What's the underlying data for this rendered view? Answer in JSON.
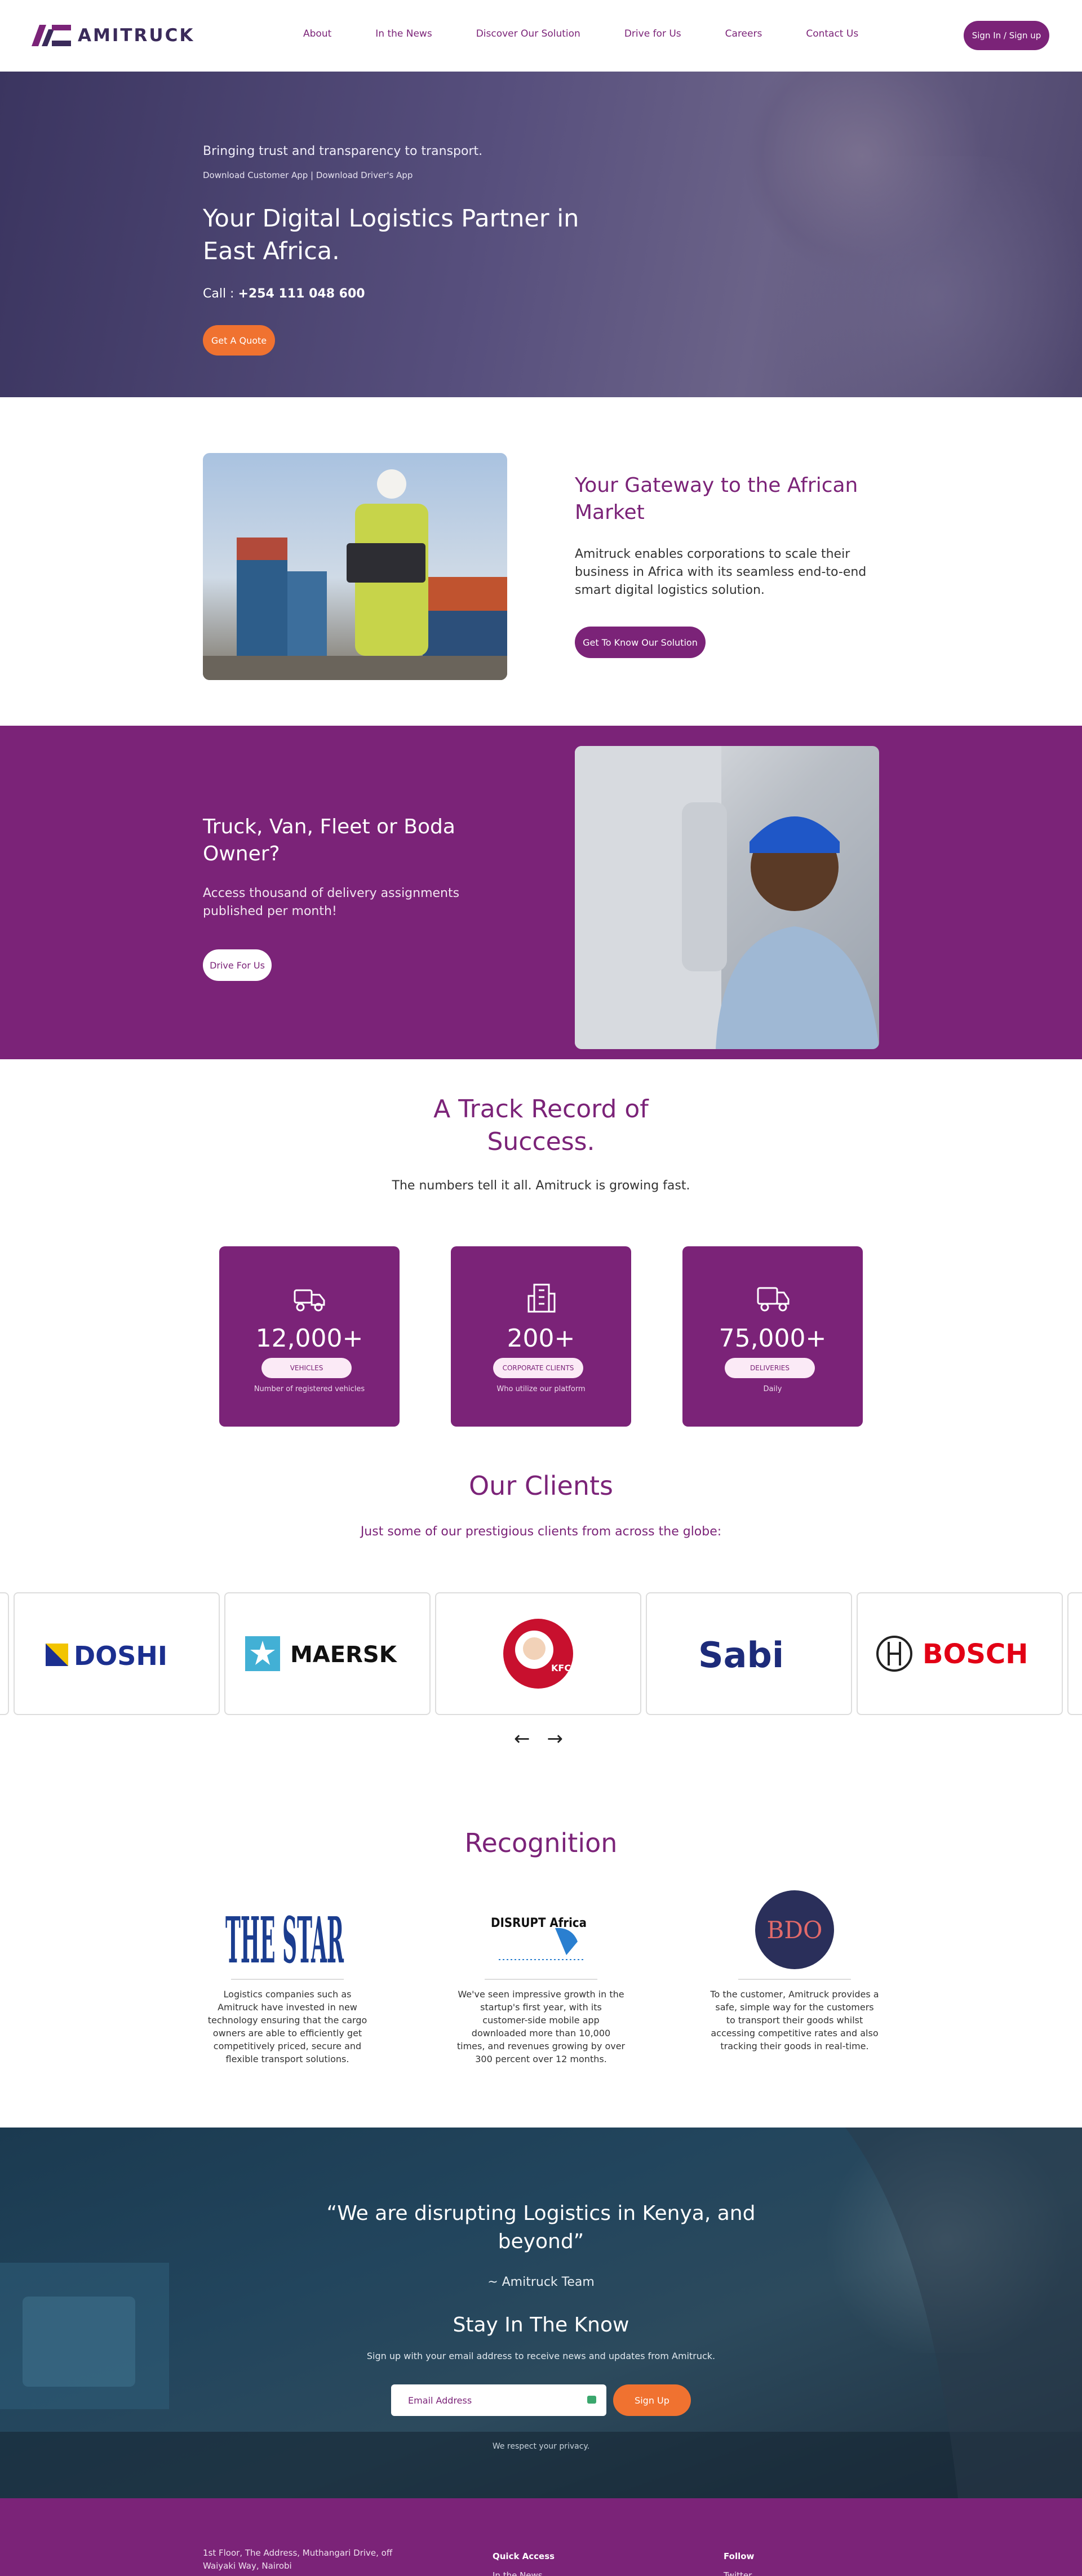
{
  "brand": {
    "name": "AMITRUCK",
    "accent": "#7b2378",
    "orange": "#f07230"
  },
  "nav": {
    "items": [
      "About",
      "In the News",
      "Discover Our Solution",
      "Drive for Us",
      "Careers",
      "Contact Us"
    ],
    "signin": "Sign In / Sign up"
  },
  "hero": {
    "tagline": "Bringing trust and transparency to transport.",
    "app_links": "Download Customer App | Download Driver's App",
    "title": "Your Digital Logistics Partner in East Africa.",
    "call_label": "Call :",
    "phone": "+254 111 048 600",
    "quote_button": "Get A Quote"
  },
  "gateway": {
    "title": "Your Gateway to the African Market",
    "text": "Amitruck enables corporations to scale their business in Africa with its seamless end-to-end smart digital logistics solution.",
    "button": "Get To Know Our Solution"
  },
  "driver": {
    "title": "Truck, Van, Fleet or Boda Owner?",
    "text": "Access thousand of delivery assignments published per month!",
    "button": "Drive For Us"
  },
  "track": {
    "title_line1": "A Track Record of",
    "title_line2": "Success.",
    "subtitle": "The numbers tell it all. Amitruck is growing fast.",
    "stats": [
      {
        "value": "12,000+",
        "label": "VEHICLES",
        "caption": "Number of registered vehicles",
        "icon": "vehicles-icon"
      },
      {
        "value": "200+",
        "label": "CORPORATE CLIENTS",
        "caption": "Who utilize our platform",
        "icon": "building-icon"
      },
      {
        "value": "75,000+",
        "label": "DELIVERIES",
        "caption": "Daily",
        "icon": "delivery-truck-icon"
      }
    ]
  },
  "clients": {
    "title": "Our Clients",
    "subtitle": "Just some of our prestigious clients from across the globe:",
    "logos": [
      "DOSHI",
      "MAERSK",
      "KFC",
      "Sabi",
      "BOSCH"
    ],
    "prev": "←",
    "next": "→"
  },
  "recognition": {
    "title": "Recognition",
    "items": [
      {
        "logo": "THE STAR",
        "text": "Logistics companies such as Amitruck have invested in new technology ensuring that the cargo owners are able to efficiently get competitively priced, secure and flexible transport solutions."
      },
      {
        "logo": "DISRUPT Africa",
        "text": "We've seen impressive growth in the startup's first year, with its customer-side mobile app downloaded more than 10,000 times, and revenues growing by over 300 percent over 12 months."
      },
      {
        "logo": "BDO",
        "text": "To the customer, Amitruck provides a safe, simple way for the customers to transport their goods whilst accessing competitive rates and also tracking their goods in real-time."
      }
    ]
  },
  "quote": {
    "text": "“We are disrupting Logistics in Kenya, and beyond”",
    "author": "~ Amitruck Team",
    "stay_title": "Stay In The Know",
    "stay_sub": "Sign up with your email address to receive news and updates from Amitruck.",
    "email_placeholder": "Email Address",
    "signup": "Sign Up",
    "privacy": "We respect your privacy."
  },
  "footer": {
    "address": "1st Floor, The Address, Muthangari Drive, off Waiyaki Way, Nairobi",
    "quick_title": "Quick Access",
    "quick_items": [
      "In the News"
    ],
    "follow_title": "Follow",
    "follow_items": [
      "Twitter"
    ]
  }
}
